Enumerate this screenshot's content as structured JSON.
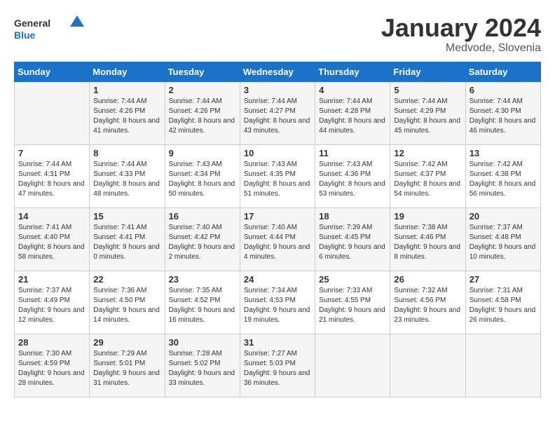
{
  "logo": {
    "general": "General",
    "blue": "Blue"
  },
  "title": "January 2024",
  "location": "Medvode, Slovenia",
  "weekdays": [
    "Sunday",
    "Monday",
    "Tuesday",
    "Wednesday",
    "Thursday",
    "Friday",
    "Saturday"
  ],
  "weeks": [
    [
      {
        "day": "",
        "sunrise": "",
        "sunset": "",
        "daylight": ""
      },
      {
        "day": "1",
        "sunrise": "Sunrise: 7:44 AM",
        "sunset": "Sunset: 4:26 PM",
        "daylight": "Daylight: 8 hours and 41 minutes."
      },
      {
        "day": "2",
        "sunrise": "Sunrise: 7:44 AM",
        "sunset": "Sunset: 4:26 PM",
        "daylight": "Daylight: 8 hours and 42 minutes."
      },
      {
        "day": "3",
        "sunrise": "Sunrise: 7:44 AM",
        "sunset": "Sunset: 4:27 PM",
        "daylight": "Daylight: 8 hours and 43 minutes."
      },
      {
        "day": "4",
        "sunrise": "Sunrise: 7:44 AM",
        "sunset": "Sunset: 4:28 PM",
        "daylight": "Daylight: 8 hours and 44 minutes."
      },
      {
        "day": "5",
        "sunrise": "Sunrise: 7:44 AM",
        "sunset": "Sunset: 4:29 PM",
        "daylight": "Daylight: 8 hours and 45 minutes."
      },
      {
        "day": "6",
        "sunrise": "Sunrise: 7:44 AM",
        "sunset": "Sunset: 4:30 PM",
        "daylight": "Daylight: 8 hours and 46 minutes."
      }
    ],
    [
      {
        "day": "7",
        "sunrise": "Sunrise: 7:44 AM",
        "sunset": "Sunset: 4:31 PM",
        "daylight": "Daylight: 8 hours and 47 minutes."
      },
      {
        "day": "8",
        "sunrise": "Sunrise: 7:44 AM",
        "sunset": "Sunset: 4:33 PM",
        "daylight": "Daylight: 8 hours and 48 minutes."
      },
      {
        "day": "9",
        "sunrise": "Sunrise: 7:43 AM",
        "sunset": "Sunset: 4:34 PM",
        "daylight": "Daylight: 8 hours and 50 minutes."
      },
      {
        "day": "10",
        "sunrise": "Sunrise: 7:43 AM",
        "sunset": "Sunset: 4:35 PM",
        "daylight": "Daylight: 8 hours and 51 minutes."
      },
      {
        "day": "11",
        "sunrise": "Sunrise: 7:43 AM",
        "sunset": "Sunset: 4:36 PM",
        "daylight": "Daylight: 8 hours and 53 minutes."
      },
      {
        "day": "12",
        "sunrise": "Sunrise: 7:42 AM",
        "sunset": "Sunset: 4:37 PM",
        "daylight": "Daylight: 8 hours and 54 minutes."
      },
      {
        "day": "13",
        "sunrise": "Sunrise: 7:42 AM",
        "sunset": "Sunset: 4:38 PM",
        "daylight": "Daylight: 8 hours and 56 minutes."
      }
    ],
    [
      {
        "day": "14",
        "sunrise": "Sunrise: 7:41 AM",
        "sunset": "Sunset: 4:40 PM",
        "daylight": "Daylight: 8 hours and 58 minutes."
      },
      {
        "day": "15",
        "sunrise": "Sunrise: 7:41 AM",
        "sunset": "Sunset: 4:41 PM",
        "daylight": "Daylight: 9 hours and 0 minutes."
      },
      {
        "day": "16",
        "sunrise": "Sunrise: 7:40 AM",
        "sunset": "Sunset: 4:42 PM",
        "daylight": "Daylight: 9 hours and 2 minutes."
      },
      {
        "day": "17",
        "sunrise": "Sunrise: 7:40 AM",
        "sunset": "Sunset: 4:44 PM",
        "daylight": "Daylight: 9 hours and 4 minutes."
      },
      {
        "day": "18",
        "sunrise": "Sunrise: 7:39 AM",
        "sunset": "Sunset: 4:45 PM",
        "daylight": "Daylight: 9 hours and 6 minutes."
      },
      {
        "day": "19",
        "sunrise": "Sunrise: 7:38 AM",
        "sunset": "Sunset: 4:46 PM",
        "daylight": "Daylight: 9 hours and 8 minutes."
      },
      {
        "day": "20",
        "sunrise": "Sunrise: 7:37 AM",
        "sunset": "Sunset: 4:48 PM",
        "daylight": "Daylight: 9 hours and 10 minutes."
      }
    ],
    [
      {
        "day": "21",
        "sunrise": "Sunrise: 7:37 AM",
        "sunset": "Sunset: 4:49 PM",
        "daylight": "Daylight: 9 hours and 12 minutes."
      },
      {
        "day": "22",
        "sunrise": "Sunrise: 7:36 AM",
        "sunset": "Sunset: 4:50 PM",
        "daylight": "Daylight: 9 hours and 14 minutes."
      },
      {
        "day": "23",
        "sunrise": "Sunrise: 7:35 AM",
        "sunset": "Sunset: 4:52 PM",
        "daylight": "Daylight: 9 hours and 16 minutes."
      },
      {
        "day": "24",
        "sunrise": "Sunrise: 7:34 AM",
        "sunset": "Sunset: 4:53 PM",
        "daylight": "Daylight: 9 hours and 19 minutes."
      },
      {
        "day": "25",
        "sunrise": "Sunrise: 7:33 AM",
        "sunset": "Sunset: 4:55 PM",
        "daylight": "Daylight: 9 hours and 21 minutes."
      },
      {
        "day": "26",
        "sunrise": "Sunrise: 7:32 AM",
        "sunset": "Sunset: 4:56 PM",
        "daylight": "Daylight: 9 hours and 23 minutes."
      },
      {
        "day": "27",
        "sunrise": "Sunrise: 7:31 AM",
        "sunset": "Sunset: 4:58 PM",
        "daylight": "Daylight: 9 hours and 26 minutes."
      }
    ],
    [
      {
        "day": "28",
        "sunrise": "Sunrise: 7:30 AM",
        "sunset": "Sunset: 4:59 PM",
        "daylight": "Daylight: 9 hours and 28 minutes."
      },
      {
        "day": "29",
        "sunrise": "Sunrise: 7:29 AM",
        "sunset": "Sunset: 5:01 PM",
        "daylight": "Daylight: 9 hours and 31 minutes."
      },
      {
        "day": "30",
        "sunrise": "Sunrise: 7:28 AM",
        "sunset": "Sunset: 5:02 PM",
        "daylight": "Daylight: 9 hours and 33 minutes."
      },
      {
        "day": "31",
        "sunrise": "Sunrise: 7:27 AM",
        "sunset": "Sunset: 5:03 PM",
        "daylight": "Daylight: 9 hours and 36 minutes."
      },
      {
        "day": "",
        "sunrise": "",
        "sunset": "",
        "daylight": ""
      },
      {
        "day": "",
        "sunrise": "",
        "sunset": "",
        "daylight": ""
      },
      {
        "day": "",
        "sunrise": "",
        "sunset": "",
        "daylight": ""
      }
    ]
  ]
}
